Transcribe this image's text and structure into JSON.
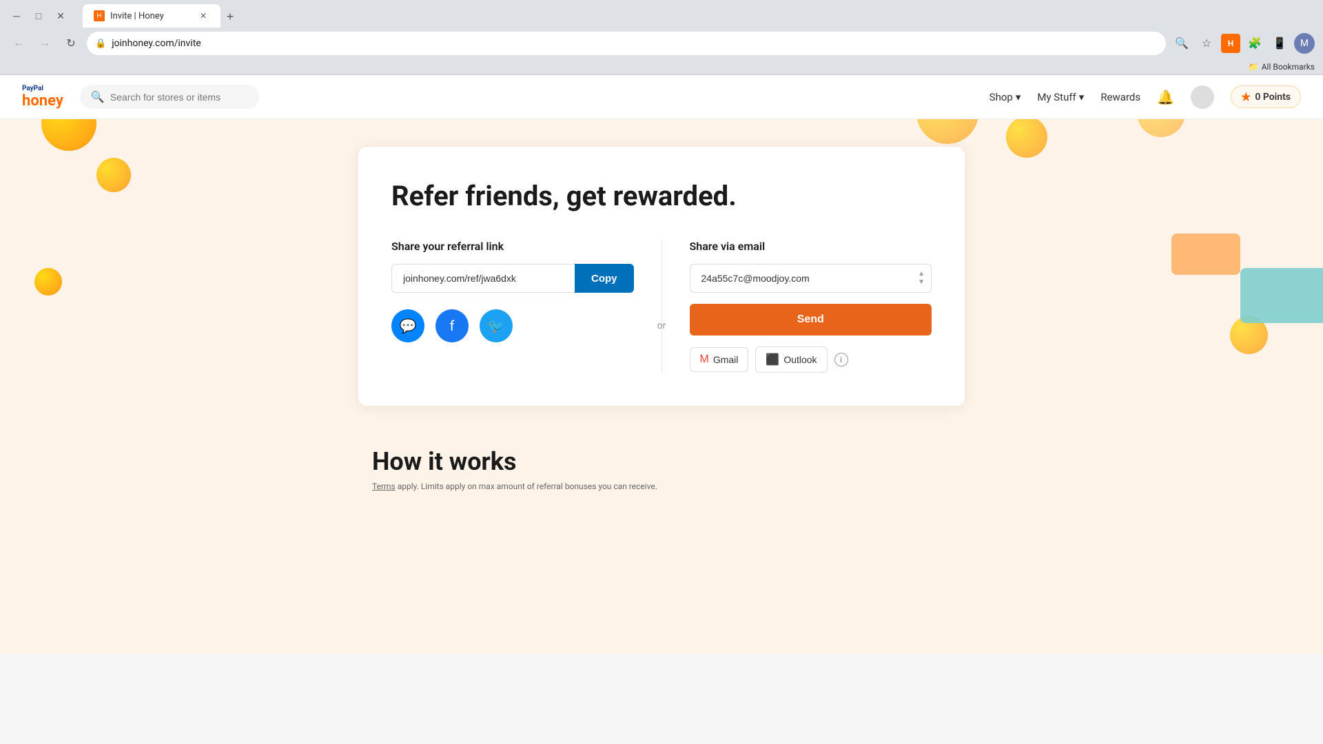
{
  "browser": {
    "tab_title": "Invite | Honey",
    "tab_favicon": "H",
    "url": "joinhoney.com/invite",
    "new_tab_label": "+",
    "nav": {
      "back": "←",
      "forward": "→",
      "refresh": "↻"
    },
    "bookmarks": "All Bookmarks"
  },
  "navbar": {
    "logo_paypal": "PayPal",
    "logo_honey": "honey",
    "search_placeholder": "Search for stores or items",
    "shop": "Shop",
    "my_stuff": "My Stuff",
    "rewards": "Rewards",
    "points": "0 Points"
  },
  "page": {
    "title": "Refer friends, get rewarded.",
    "left": {
      "label": "Share your referral link",
      "referral_url": "joinhoney.com/ref/jwa6dxk",
      "copy_label": "Copy",
      "or_text": "or"
    },
    "right": {
      "label": "Share via email",
      "email_value": "24a55c7c@moodjoy.com",
      "send_label": "Send",
      "gmail_label": "Gmail",
      "outlook_label": "Outlook"
    },
    "how_title": "How it works",
    "terms_text": "Terms apply. Limits apply on max amount of referral bonuses you can receive."
  }
}
